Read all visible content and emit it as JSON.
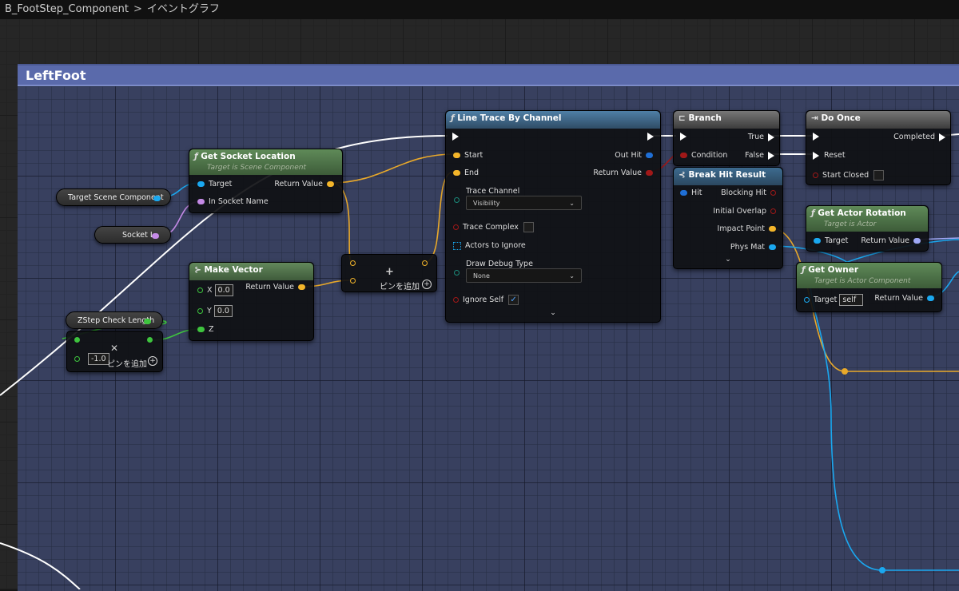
{
  "breadcrumb": {
    "blueprint": "B_FootStep_Component",
    "separator": ">",
    "graph": "イベントグラフ"
  },
  "comment": {
    "title": "LeftFoot"
  },
  "nodes": {
    "get_socket_location": {
      "title": "Get Socket Location",
      "subtitle": "Target is Scene Component",
      "target": "Target",
      "in_socket_name": "In Socket Name",
      "return_value": "Return Value"
    },
    "make_vector": {
      "title": "Make Vector",
      "x_label": "X",
      "x_value": "0.0",
      "y_label": "Y",
      "y_value": "0.0",
      "z_label": "Z",
      "return_value": "Return Value"
    },
    "add_node": {
      "plus": "+",
      "add_pin": "ピンを追加"
    },
    "multiply_node": {
      "close": "✕",
      "value": "-1.0",
      "add_pin": "ピンを追加"
    },
    "line_trace": {
      "title": "Line Trace By Channel",
      "start": "Start",
      "end": "End",
      "trace_channel": "Trace Channel",
      "trace_channel_value": "Visibility",
      "trace_complex": "Trace Complex",
      "actors_to_ignore": "Actors to Ignore",
      "draw_debug_type": "Draw Debug Type",
      "draw_debug_value": "None",
      "ignore_self": "Ignore Self",
      "out_hit": "Out Hit",
      "return_value": "Return Value"
    },
    "branch": {
      "title": "Branch",
      "condition": "Condition",
      "true": "True",
      "false": "False"
    },
    "break_hit": {
      "title": "Break Hit Result",
      "hit": "Hit",
      "blocking_hit": "Blocking Hit",
      "initial_overlap": "Initial Overlap",
      "impact_point": "Impact Point",
      "phys_mat": "Phys Mat"
    },
    "do_once": {
      "title": "Do Once",
      "completed": "Completed",
      "reset": "Reset",
      "start_closed": "Start Closed"
    },
    "get_actor_rotation": {
      "title": "Get Actor Rotation",
      "subtitle": "Target is Actor",
      "target": "Target",
      "return_value": "Return Value"
    },
    "get_owner": {
      "title": "Get Owner",
      "subtitle": "Target is Actor Component",
      "target": "Target",
      "target_value": "self",
      "return_value": "Return Value"
    }
  },
  "variables": {
    "target_scene_component": "Target Scene Component",
    "socket_l": "Socket L",
    "zstep_check_length": "ZStep Check Length"
  },
  "colors": {
    "exec": "#ffffff",
    "vector": "#f3b52a",
    "object": "#1aa8f0",
    "name": "#c48ae6",
    "float": "#3ec43e",
    "bool": "#8b0000",
    "struct": "#1f6fd6",
    "rotator": "#9fa8f5",
    "comment_header": "#5a6aab"
  }
}
